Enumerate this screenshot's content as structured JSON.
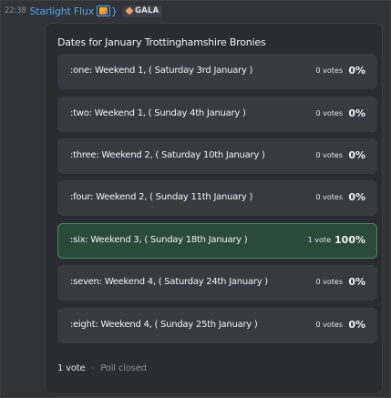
{
  "message": {
    "timestamp": "22:38",
    "author": "Starlight Flux",
    "author_bracket_close": "}",
    "author_emoji_icon": "rainbow-star-emoji-icon",
    "tag_label": "GALA",
    "tag_icon": "gala-badge-icon"
  },
  "poll": {
    "question": "Dates for January Trottinghamshire Bronies",
    "options": [
      {
        "label": ":one: Weekend 1, ( Saturday 3rd January )",
        "votes": "0 votes",
        "percent": "0%",
        "selected": false
      },
      {
        "label": ":two: Weekend 1, ( Sunday 4th January )",
        "votes": "0 votes",
        "percent": "0%",
        "selected": false
      },
      {
        "label": ":three: Weekend 2, ( Saturday 10th January )",
        "votes": "0 votes",
        "percent": "0%",
        "selected": false
      },
      {
        "label": ":four: Weekend 2, ( Sunday 11th January )",
        "votes": "0 votes",
        "percent": "0%",
        "selected": false
      },
      {
        "label": ":six: Weekend 3, ( Sunday 18th January )",
        "votes": "1 vote",
        "percent": "100%",
        "selected": true
      },
      {
        "label": ":seven: Weekend 4, ( Saturday 24th January )",
        "votes": "0 votes",
        "percent": "0%",
        "selected": false
      },
      {
        "label": ":eight: Weekend 4, ( Sunday 25th January )",
        "votes": "0 votes",
        "percent": "0%",
        "selected": false
      }
    ],
    "total_votes": "1 vote",
    "separator": "·",
    "status": "Poll closed"
  },
  "colors": {
    "background": "#323339",
    "poll_background": "#2b2c31",
    "option_background": "#393a41",
    "selected_background": "#2b4a3a",
    "selected_border": "#3f8f5a",
    "author": "#4fa7e8"
  }
}
